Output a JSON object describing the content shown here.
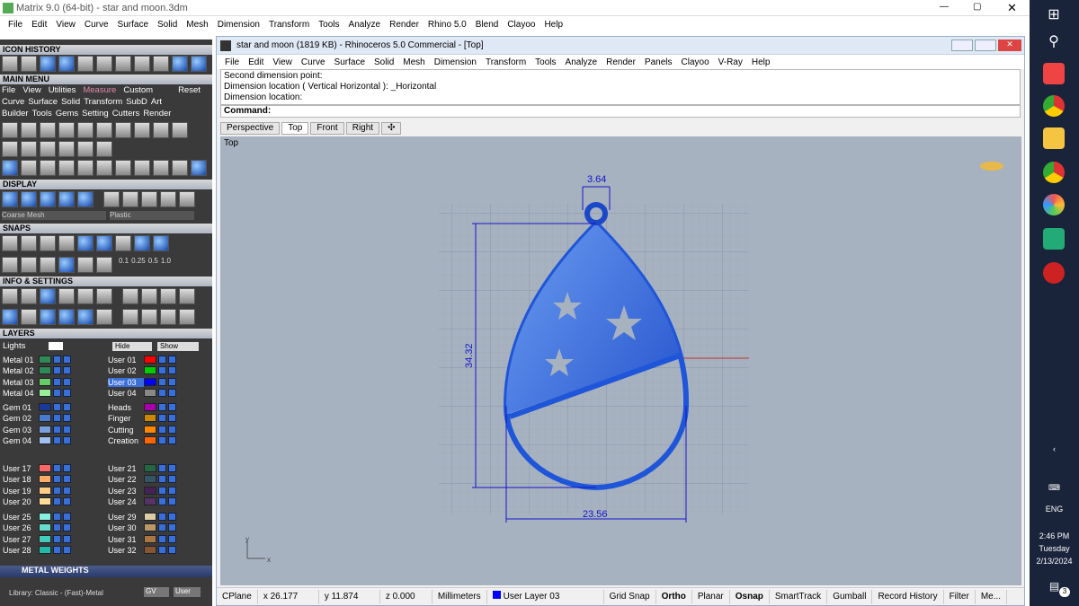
{
  "outer": {
    "title": "Matrix 9.0 (64-bit) - star and moon.3dm",
    "menu": [
      "File",
      "Edit",
      "View",
      "Curve",
      "Surface",
      "Solid",
      "Mesh",
      "Dimension",
      "Transform",
      "Tools",
      "Analyze",
      "Render",
      "Rhino 5.0",
      "Blend",
      "Clayoo",
      "Help"
    ]
  },
  "panel": {
    "icon_history": "ICON HISTORY",
    "main_menu": "MAIN MENU",
    "mm_row1": [
      "File",
      "View",
      "Utilities",
      "Measure",
      "Custom",
      "Reset"
    ],
    "mm_row2": [
      "Curve",
      "Surface",
      "Solid",
      "Transform",
      "SubD",
      "Art"
    ],
    "mm_row3": [
      "Builder",
      "Tools",
      "Gems",
      "Setting",
      "Cutters",
      "Render"
    ],
    "display": "DISPLAY",
    "coarse": "Coarse Mesh",
    "plastic": "Plastic",
    "snaps": "SNAPS",
    "snap_vals": [
      "0.1",
      "0.25",
      "0.5",
      "1.0"
    ],
    "info": "INFO & SETTINGS",
    "layers": "LAYERS",
    "lights": "Lights",
    "hide": "Hide",
    "show": "Show",
    "metal_weights": "METAL WEIGHTS",
    "library": "Library: Classic - (Fast)-Metal",
    "gv": "GV",
    "user": "User"
  },
  "layers_left": [
    "Metal 01",
    "Metal 02",
    "Metal 03",
    "Metal 04",
    "Gem 01",
    "Gem 02",
    "Gem 03",
    "Gem 04",
    "User 17",
    "User 18",
    "User 19",
    "User 20",
    "User 25",
    "User 26",
    "User 27",
    "User 28"
  ],
  "layers_right": [
    "User 01",
    "User 02",
    "User 03",
    "User 04",
    "Heads",
    "Finger",
    "Cutting",
    "Creation",
    "User 21",
    "User 22",
    "User 23",
    "User 24",
    "User 29",
    "User 30",
    "User 31",
    "User 32"
  ],
  "colors_left": [
    "#2e8b57",
    "#2e8b57",
    "#66cc66",
    "#99ee99",
    "#1a3a9a",
    "#4a7ad0",
    "#7aa0e0",
    "#a0c0f0",
    "#ff6666",
    "#ffaa66",
    "#ffcc88",
    "#ffdd99",
    "#88eedd",
    "#66ddcc",
    "#44ccbb",
    "#22bbaa"
  ],
  "colors_right": [
    "#ff0000",
    "#00cc00",
    "#0000ff",
    "#888888",
    "#aa00aa",
    "#cc8800",
    "#ff8800",
    "#ff6600",
    "#226644",
    "#335566",
    "#442255",
    "#553366",
    "#ddccaa",
    "#bb9966",
    "#aa7744",
    "#885533"
  ],
  "rhino": {
    "title": "star and moon (1819 KB) - Rhinoceros 5.0 Commercial - [Top]",
    "menu": [
      "File",
      "Edit",
      "View",
      "Curve",
      "Surface",
      "Solid",
      "Mesh",
      "Dimension",
      "Transform",
      "Tools",
      "Analyze",
      "Render",
      "Panels",
      "Clayoo",
      "V-Ray",
      "Help"
    ],
    "history": [
      "Second dimension point:",
      "Dimension location ( Vertical  Horizontal ): _Horizontal",
      "Dimension location:"
    ],
    "command": "Command:",
    "tabs": [
      "Perspective",
      "Top",
      "Front",
      "Right"
    ],
    "viewport": "Top"
  },
  "dims": {
    "top": "3.64",
    "side": "34.32",
    "bottom": "23.56"
  },
  "axes": {
    "x": "x",
    "y": "y"
  },
  "status": [
    "CPlane",
    "x 26.177",
    "y 11.874",
    "z 0.000",
    "Millimeters",
    "User Layer 03",
    "Grid Snap",
    "Ortho",
    "Planar",
    "Osnap",
    "SmartTrack",
    "Gumball",
    "Record History",
    "Filter",
    "Me..."
  ],
  "clock": {
    "time": "2:46 PM",
    "day": "Tuesday",
    "date": "2/13/2024",
    "lang": "ENG",
    "badge": "3"
  }
}
